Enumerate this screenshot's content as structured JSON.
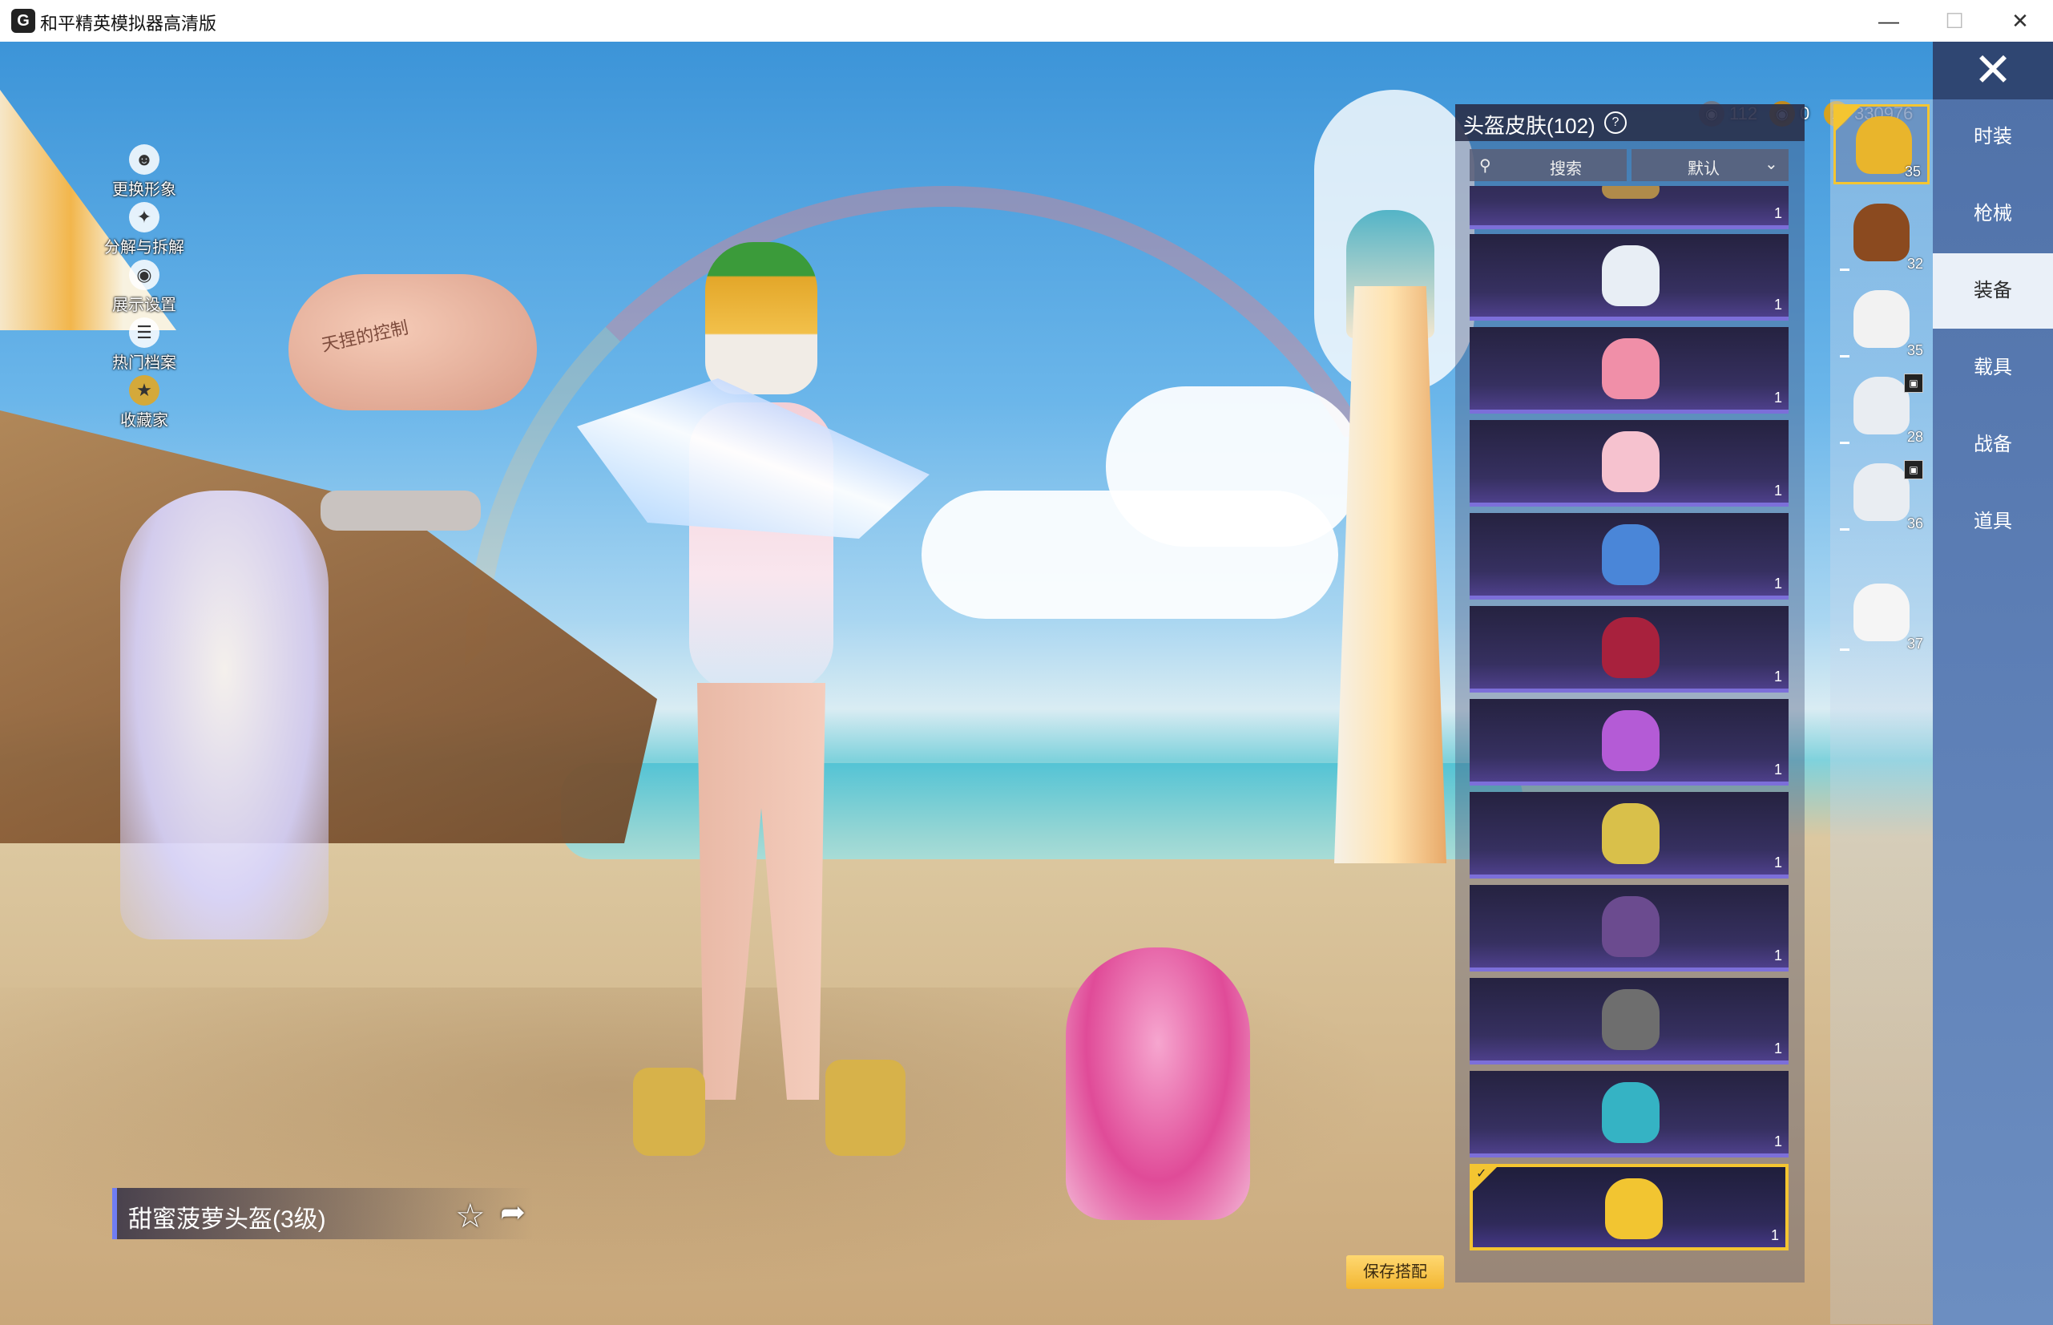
{
  "window": {
    "title": "和平精英模拟器高清版",
    "icon": "app-logo-icon",
    "controls": {
      "minimize": "—",
      "maximize": "☐",
      "close": "✕"
    }
  },
  "scene": {
    "balloon_text": "天捏的控制"
  },
  "left_menu": {
    "items": [
      {
        "label": "更换形象",
        "icon": "person-icon"
      },
      {
        "label": "分解与拆解",
        "icon": "puzzle-icon"
      },
      {
        "label": "展示设置",
        "icon": "eye-icon"
      },
      {
        "label": "热门档案",
        "icon": "file-icon"
      },
      {
        "label": "收藏家",
        "icon": "collector-badge-icon"
      }
    ]
  },
  "currency": {
    "items": [
      {
        "icon": "silver-coin-icon",
        "value": "112",
        "color": "#6d7b8f"
      },
      {
        "icon": "gold-coin-icon",
        "value": "0",
        "color": "#c08a1e"
      },
      {
        "icon": "points-coin-icon",
        "value": "330976",
        "color": "#d6a21f"
      }
    ]
  },
  "list_panel": {
    "title": "头盔皮肤(102)",
    "search_label": "搜索",
    "sort_label": "默认",
    "items": [
      {
        "count": "1",
        "art_color": "#b08b4a",
        "icon": "helmet-gold-partial-icon",
        "selected": false
      },
      {
        "count": "1",
        "art_color": "#e8eef5",
        "icon": "helmet-white-bunny-icon",
        "selected": false
      },
      {
        "count": "1",
        "art_color": "#f08fa8",
        "icon": "helmet-pink-pig-icon",
        "selected": false
      },
      {
        "count": "1",
        "art_color": "#f6c2cf",
        "icon": "helmet-pink-cat-icon",
        "selected": false
      },
      {
        "count": "1",
        "art_color": "#4a86d8",
        "icon": "helmet-blue-bow-icon",
        "selected": false
      },
      {
        "count": "1",
        "art_color": "#a8213d",
        "icon": "helmet-red-racing-icon",
        "selected": false
      },
      {
        "count": "1",
        "art_color": "#b45bd6",
        "icon": "helmet-purple-unicorn-icon",
        "selected": false
      },
      {
        "count": "1",
        "art_color": "#d9c04a",
        "icon": "helmet-chick-icon",
        "selected": false
      },
      {
        "count": "1",
        "art_color": "#6b4b8f",
        "icon": "helmet-purple-mech-icon",
        "selected": false
      },
      {
        "count": "1",
        "art_color": "#6e6e6e",
        "icon": "helmet-tactical-icon",
        "selected": false
      },
      {
        "count": "1",
        "art_color": "#35b3c4",
        "icon": "helmet-cyan-icon",
        "selected": false
      },
      {
        "count": "1",
        "art_color": "#f2c531",
        "icon": "helmet-pineapple-icon",
        "selected": true
      }
    ]
  },
  "slots": {
    "items": [
      {
        "num": "35",
        "art_color": "#e9b52c",
        "icon": "pineapple-helmet-slot-icon",
        "selected": true,
        "locked": false
      },
      {
        "num": "32",
        "art_color": "#8b4a1f",
        "icon": "rooster-helmet-slot-icon",
        "selected": false,
        "locked": false
      },
      {
        "num": "35",
        "art_color": "#f2f2f2",
        "icon": "white-helmet-slot-icon",
        "selected": false,
        "locked": false
      },
      {
        "num": "28",
        "art_color": "#e9edf2",
        "icon": "snowman-vest-slot-icon",
        "selected": false,
        "locked": true
      },
      {
        "num": "36",
        "art_color": "#e9edf2",
        "icon": "snowman-backpack-slot-icon",
        "selected": false,
        "locked": true
      },
      {
        "num": "37",
        "art_color": "#f5f5f5",
        "icon": "bunny-backpack-slot-icon",
        "selected": false,
        "locked": false
      }
    ]
  },
  "categories": {
    "close_label": "✕",
    "tabs": [
      {
        "label": "时装",
        "active": false
      },
      {
        "label": "枪械",
        "active": false
      },
      {
        "label": "装备",
        "active": true
      },
      {
        "label": "载具",
        "active": false
      },
      {
        "label": "战备",
        "active": false
      },
      {
        "label": "道具",
        "active": false
      }
    ]
  },
  "bottom": {
    "item_name": "甜蜜菠萝头盔(3级)",
    "favorite_icon": "star-plus-icon",
    "share_icon": "share-icon",
    "save_label": "保存搭配"
  }
}
